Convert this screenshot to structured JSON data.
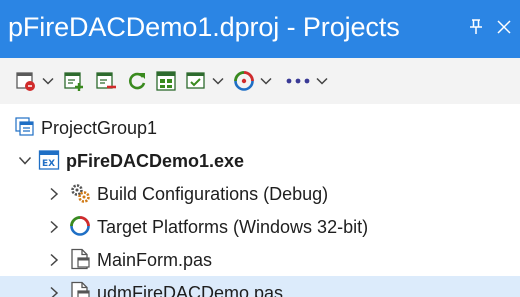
{
  "window": {
    "title": "pFireDACDemo1.dproj - Projects",
    "pin_glyph": "२",
    "close_glyph": "✕"
  },
  "toolbar": {
    "buttons": [
      {
        "icon": "sync-project-icon"
      },
      {
        "icon": "add-new-project-icon"
      },
      {
        "icon": "remove-project-icon"
      },
      {
        "icon": "refresh-icon"
      },
      {
        "icon": "build-configurations-icon"
      },
      {
        "icon": "view-options-icon"
      },
      {
        "icon": "target-platform-icon"
      },
      {
        "icon": "more-options-icon"
      }
    ],
    "more_glyph": "•••"
  },
  "tree": {
    "items": [
      {
        "label": "ProjectGroup1",
        "icon": "project-group-icon",
        "expander": "none"
      },
      {
        "label": "pFireDACDemo1.exe",
        "icon": "exe-project-icon",
        "expander": "expanded"
      },
      {
        "label": "Build Configurations (Debug)",
        "icon": "gears-icon",
        "expander": "collapsed"
      },
      {
        "label": "Target Platforms (Windows 32-bit)",
        "icon": "target-platforms-icon",
        "expander": "collapsed"
      },
      {
        "label": "MainForm.pas",
        "icon": "form-unit-icon",
        "expander": "collapsed"
      },
      {
        "label": "udmFireDACDemo.pas",
        "icon": "form-unit-icon",
        "expander": "collapsed",
        "selected": true
      }
    ]
  },
  "colors": {
    "titlebar": "#2b85e4",
    "toolbar": "#f3f3f3",
    "selection": "#dcebfb",
    "accent_green": "#3a8a1e",
    "accent_red": "#d12b2b",
    "icon_blue": "#1f6fc5"
  }
}
